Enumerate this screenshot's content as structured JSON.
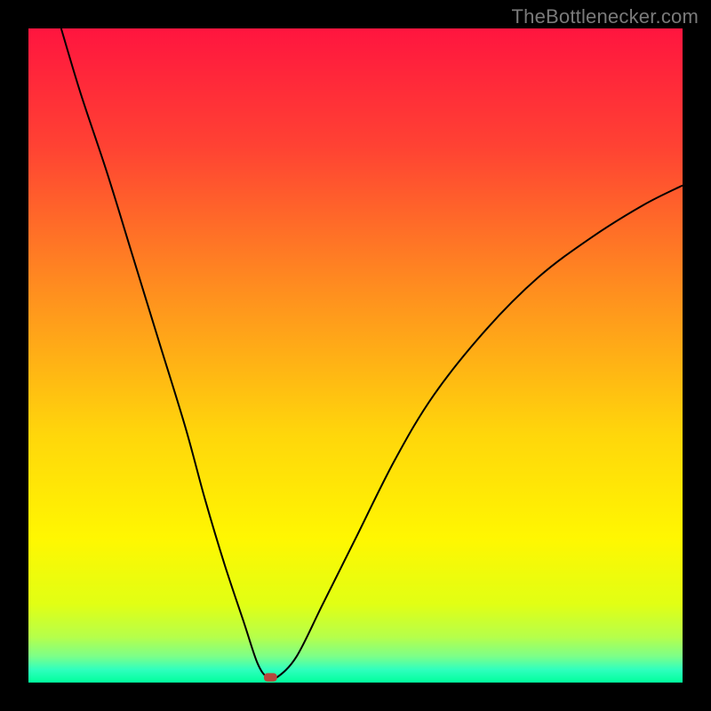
{
  "watermark": "TheBottlenecker.com",
  "chart_data": {
    "type": "line",
    "title": "",
    "xlabel": "",
    "ylabel": "",
    "xlim": [
      0,
      100
    ],
    "ylim": [
      0,
      100
    ],
    "grid": false,
    "legend": false,
    "background": {
      "type": "vertical-gradient",
      "stops": [
        {
          "pct": 0,
          "color": "#ff153f"
        },
        {
          "pct": 18,
          "color": "#ff4233"
        },
        {
          "pct": 40,
          "color": "#ff8e1f"
        },
        {
          "pct": 62,
          "color": "#ffd60b"
        },
        {
          "pct": 78,
          "color": "#fff701"
        },
        {
          "pct": 88,
          "color": "#e1ff14"
        },
        {
          "pct": 93,
          "color": "#b6ff4a"
        },
        {
          "pct": 96,
          "color": "#7cff89"
        },
        {
          "pct": 98,
          "color": "#30ffbe"
        },
        {
          "pct": 100,
          "color": "#00ff9c"
        }
      ]
    },
    "series": [
      {
        "name": "bottleneck-curve",
        "color": "#000000",
        "stroke_width": 2,
        "points": [
          {
            "x": 5,
            "y": 100
          },
          {
            "x": 8,
            "y": 90
          },
          {
            "x": 12,
            "y": 78
          },
          {
            "x": 16,
            "y": 65
          },
          {
            "x": 20,
            "y": 52
          },
          {
            "x": 24,
            "y": 39
          },
          {
            "x": 27,
            "y": 28
          },
          {
            "x": 30,
            "y": 18
          },
          {
            "x": 33,
            "y": 9
          },
          {
            "x": 35,
            "y": 3
          },
          {
            "x": 36.5,
            "y": 0.8
          },
          {
            "x": 38,
            "y": 0.8
          },
          {
            "x": 41,
            "y": 4
          },
          {
            "x": 45,
            "y": 12
          },
          {
            "x": 50,
            "y": 22
          },
          {
            "x": 56,
            "y": 34
          },
          {
            "x": 62,
            "y": 44
          },
          {
            "x": 70,
            "y": 54
          },
          {
            "x": 78,
            "y": 62
          },
          {
            "x": 86,
            "y": 68
          },
          {
            "x": 94,
            "y": 73
          },
          {
            "x": 100,
            "y": 76
          }
        ]
      }
    ],
    "markers": [
      {
        "name": "optimal-point",
        "shape": "rounded-rect",
        "x": 37,
        "y": 0.8,
        "width_pct": 2.0,
        "height_pct": 1.3,
        "fill": "#b6463c"
      }
    ]
  }
}
